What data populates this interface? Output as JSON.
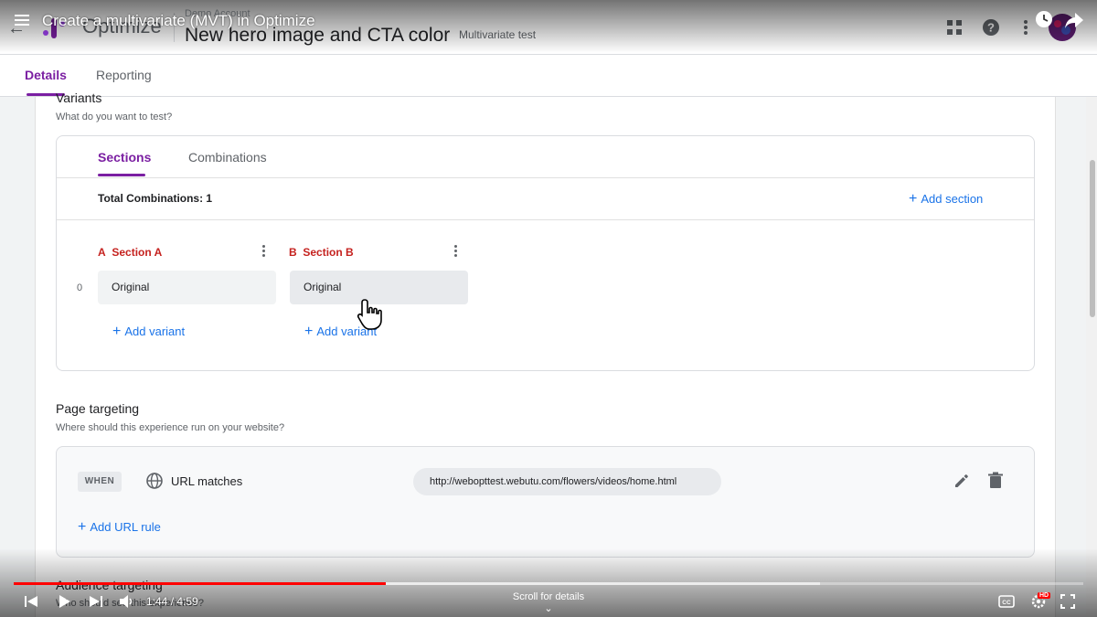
{
  "header": {
    "product": "Optimize",
    "account": "Demo Account",
    "experiment_title": "New hero image and CTA color",
    "experiment_type": "Multivariate test"
  },
  "tabs": [
    {
      "label": "Details",
      "active": true
    },
    {
      "label": "Reporting",
      "active": false
    }
  ],
  "variants": {
    "title": "Variants",
    "subtitle": "What do you want to test?",
    "subtabs": [
      {
        "label": "Sections",
        "active": true
      },
      {
        "label": "Combinations",
        "active": false
      }
    ],
    "total_combinations": "Total Combinations: 1",
    "add_section": "Add section",
    "sections": [
      {
        "letter": "A",
        "name": "Section A",
        "variant": "Original",
        "add_variant": "Add variant"
      },
      {
        "letter": "B",
        "name": "Section B",
        "variant": "Original",
        "add_variant": "Add variant"
      }
    ],
    "row_index": "0"
  },
  "page_targeting": {
    "title": "Page targeting",
    "subtitle": "Where should this experience run on your website?",
    "when": "WHEN",
    "condition": "URL matches",
    "url": "http://webopttest.webutu.com/flowers/videos/home.html",
    "add_rule": "Add URL rule"
  },
  "audience_targeting": {
    "title": "Audience targeting",
    "subtitle": "Who should see this experience?"
  },
  "video": {
    "title": "Create a multivariate (MVT) in Optimize",
    "time": "1:44 / 4:59",
    "scroll_hint": "Scroll for details",
    "progress_played": 0.348,
    "progress_buffered": 0.754,
    "quality_badge": "HD"
  },
  "colors": {
    "accent": "#7b1fa2",
    "link": "#1a73e8",
    "section_label": "#c5221f",
    "progress": "#ff0000"
  }
}
